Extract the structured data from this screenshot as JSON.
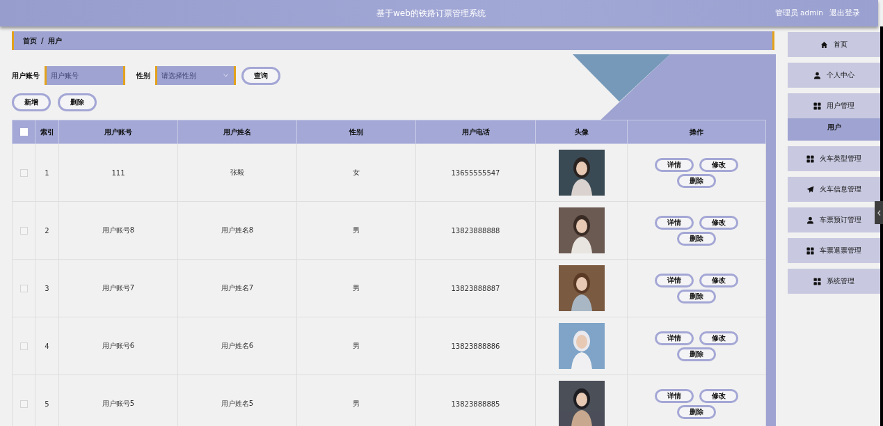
{
  "header": {
    "title": "基于web的铁路订票管理系统",
    "user_label": "管理员 admin",
    "logout": "退出登录"
  },
  "breadcrumb": {
    "items": [
      "首页",
      "用户"
    ],
    "separator": "/"
  },
  "search": {
    "fields": [
      {
        "kind": "input",
        "label": "用户账号",
        "placeholder": "用户账号"
      },
      {
        "kind": "select",
        "label": "性别",
        "placeholder": "请选择性别"
      }
    ],
    "button": "查询"
  },
  "actions": [
    "新增",
    "删除"
  ],
  "table": {
    "header_checked": false,
    "columns": [
      "索引",
      "用户账号",
      "用户姓名",
      "性别",
      "用户电话",
      "头像",
      "操作"
    ],
    "rows": [
      {
        "checked": false,
        "index": "1",
        "account": "111",
        "name": "张毅",
        "gender": "女",
        "phone": "13655555547",
        "actions": [
          "详情",
          "修改",
          "删除"
        ]
      },
      {
        "checked": false,
        "index": "2",
        "account": "用户账号8",
        "name": "用户姓名8",
        "gender": "男",
        "phone": "13823888888",
        "actions": [
          "详情",
          "修改",
          "删除"
        ]
      },
      {
        "checked": false,
        "index": "3",
        "account": "用户账号7",
        "name": "用户姓名7",
        "gender": "男",
        "phone": "13823888887",
        "actions": [
          "详情",
          "修改",
          "删除"
        ]
      },
      {
        "checked": false,
        "index": "4",
        "account": "用户账号6",
        "name": "用户姓名6",
        "gender": "男",
        "phone": "13823888886",
        "actions": [
          "详情",
          "修改",
          "删除"
        ]
      },
      {
        "checked": false,
        "index": "5",
        "account": "用户账号5",
        "name": "用户姓名5",
        "gender": "男",
        "phone": "13823888885",
        "actions": [
          "详情",
          "修改",
          "删除"
        ]
      }
    ]
  },
  "sidebar": {
    "items": [
      {
        "label": "首页",
        "selected": false
      },
      {
        "label": "个人中心",
        "selected": false
      },
      {
        "label": "用户管理",
        "selected": false,
        "children": [
          {
            "label": "用户",
            "selected": true
          }
        ]
      },
      {
        "label": "火车类型管理",
        "selected": false
      },
      {
        "label": "火车信息管理",
        "selected": false
      },
      {
        "label": "车票预订管理",
        "selected": false
      },
      {
        "label": "车票退票管理",
        "selected": false
      },
      {
        "label": "系统管理",
        "selected": false
      }
    ]
  }
}
